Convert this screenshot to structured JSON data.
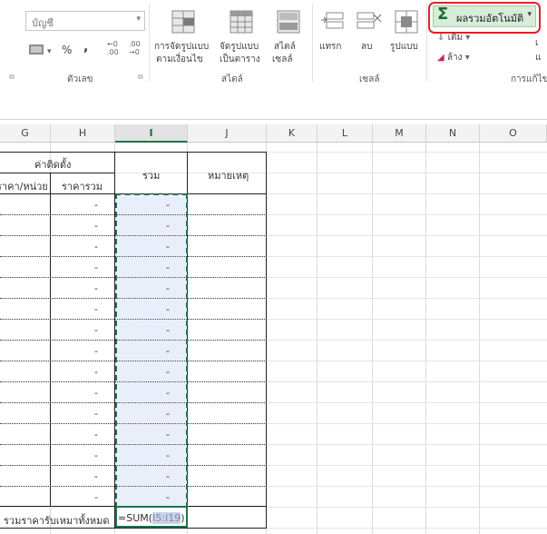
{
  "ribbon": {
    "number_format_value": "บัญชี",
    "number_group_label": "ตัวเลข",
    "styles_group_label": "สไตล์",
    "cells_group_label": "เซลล์",
    "editing_group_label": "การแก้ไข",
    "conditional_format": [
      "การจัดรูปแบบ",
      "ตามเงื่อนไข"
    ],
    "format_as_table": [
      "จัดรูปแบบ",
      "เป็นตาราง"
    ],
    "cell_styles": [
      "สไตล์",
      "เซลล์"
    ],
    "insert_label": "แทรก",
    "delete_label": "ลบ",
    "format_label": "รูปแบบ",
    "autosum_label": "ผลรวมอัตโนมัติ",
    "fill_label": "เติม",
    "clear_label": "ล้าง",
    "percent_symbol": "%",
    "comma_symbol": ",",
    "inc_decimal": ".00",
    "dec_decimal": ".00",
    "sort_partial": "เ",
    "find_partial": "แ"
  },
  "columns": [
    "G",
    "H",
    "I",
    "J",
    "K",
    "L",
    "M",
    "N",
    "O"
  ],
  "selected_column": "I",
  "table": {
    "header_install": "ค่าติดตั้ง",
    "header_unit_price": "ราคา/หน่วย",
    "header_total_price": "ราคารวม",
    "header_sum": "รวม",
    "header_note": "หมายเหตุ",
    "dash": "-",
    "footer_label": "รวมราคารับเหมาทั้งหมด",
    "formula_prefix": "=SUM(",
    "formula_ref": "I5:I19",
    "formula_suffix": ")"
  }
}
